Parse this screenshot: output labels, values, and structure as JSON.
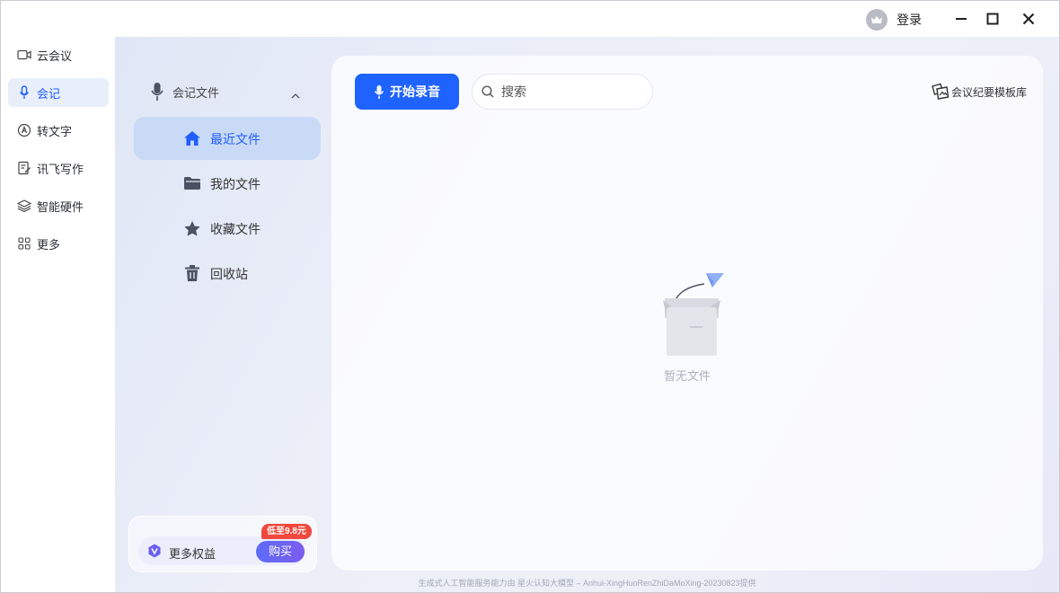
{
  "titlebar": {
    "login_label": "登录"
  },
  "rail": {
    "items": [
      {
        "label": "云会议",
        "icon": "video-camera-icon"
      },
      {
        "label": "会记",
        "icon": "microphone-icon"
      },
      {
        "label": "转文字",
        "icon": "text-convert-icon"
      },
      {
        "label": "讯飞写作",
        "icon": "writing-icon"
      },
      {
        "label": "智能硬件",
        "icon": "layers-icon"
      },
      {
        "label": "更多",
        "icon": "grid-icon"
      }
    ],
    "active_index": 1
  },
  "sub_sidebar": {
    "header": "会记文件",
    "items": [
      {
        "label": "最近文件",
        "icon": "home-icon"
      },
      {
        "label": "我的文件",
        "icon": "folder-icon"
      },
      {
        "label": "收藏文件",
        "icon": "star-icon"
      },
      {
        "label": "回收站",
        "icon": "trash-icon"
      }
    ],
    "active_index": 0
  },
  "promo": {
    "badge": "低至9.8元",
    "text": "更多权益",
    "buy_label": "购买"
  },
  "toolbar": {
    "record_label": "开始录音",
    "search_placeholder": "搜索",
    "template_label": "会议纪要模板库"
  },
  "empty": {
    "text": "暂无文件"
  },
  "footer": {
    "text": "生成式人工智能服务能力由 星火认知大模型 – Anhui-XingHuoRenZhiDaMoXing-20230823提供"
  },
  "colors": {
    "accent": "#1f63ff",
    "active_sub_bg": "#c9daf6",
    "badge": "#f0483d"
  }
}
